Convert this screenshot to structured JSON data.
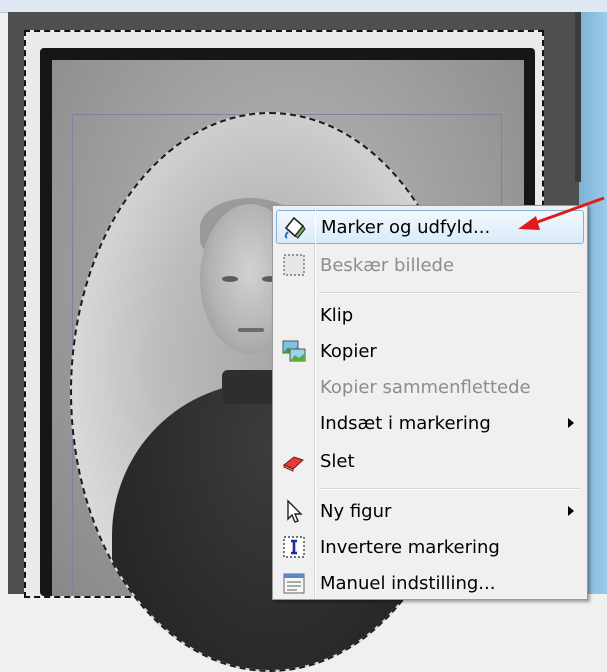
{
  "context_menu": {
    "items": [
      {
        "label": "Marker og udfyld...",
        "icon": "select-fill-icon",
        "highlighted": true,
        "disabled": false,
        "submenu": false
      },
      {
        "label": "Beskær billede",
        "icon": "crop-icon",
        "highlighted": false,
        "disabled": true,
        "submenu": false
      },
      {
        "label": "Klip",
        "icon": "",
        "highlighted": false,
        "disabled": false,
        "submenu": false
      },
      {
        "label": "Kopier",
        "icon": "copy-image-icon",
        "highlighted": false,
        "disabled": false,
        "submenu": false
      },
      {
        "label": "Kopier sammenflettede",
        "icon": "",
        "highlighted": false,
        "disabled": true,
        "submenu": false
      },
      {
        "label": "Indsæt i markering",
        "icon": "",
        "highlighted": false,
        "disabled": false,
        "submenu": true
      },
      {
        "label": "Slet",
        "icon": "eraser-icon",
        "highlighted": false,
        "disabled": false,
        "submenu": false
      },
      {
        "label": "Ny figur",
        "icon": "cursor-arrow-icon",
        "highlighted": false,
        "disabled": false,
        "submenu": true
      },
      {
        "label": "Invertere markering",
        "icon": "invert-selection-icon",
        "highlighted": false,
        "disabled": false,
        "submenu": false
      },
      {
        "label": "Manuel indstilling...",
        "icon": "manual-settings-icon",
        "highlighted": false,
        "disabled": false,
        "submenu": false
      }
    ]
  },
  "colors": {
    "annotation_arrow": "#e01b1b",
    "menu_highlight_border": "#7fb2e3",
    "canvas_background": "#4f4f4f"
  }
}
